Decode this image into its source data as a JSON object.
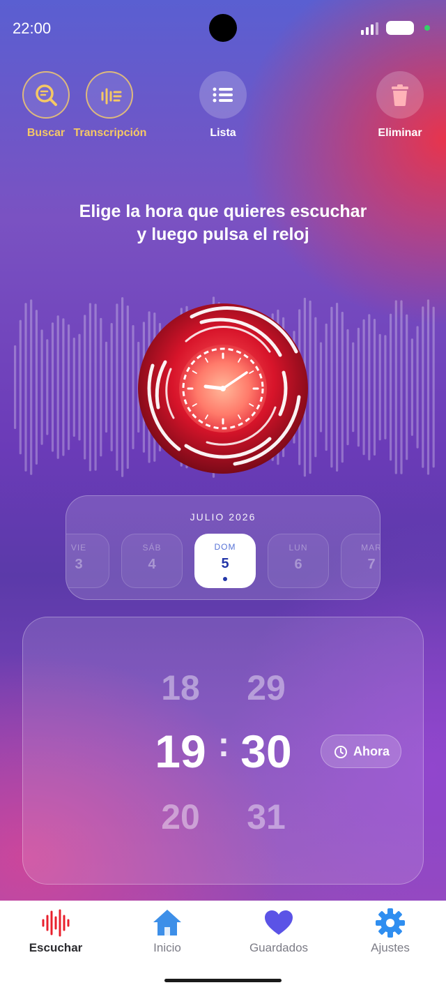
{
  "status": {
    "time": "22:00"
  },
  "toolbar": {
    "search_label": "Buscar",
    "transcription_label": "Transcripción",
    "list_label": "Lista",
    "delete_label": "Eliminar"
  },
  "headline": {
    "line1": "Elige la hora que quieres escuchar",
    "line2": "y luego pulsa el reloj"
  },
  "calendar": {
    "month": "JULIO 2026",
    "days": [
      {
        "name": "VIE",
        "num": "3"
      },
      {
        "name": "SÁB",
        "num": "4"
      },
      {
        "name": "DOM",
        "num": "5"
      },
      {
        "name": "LUN",
        "num": "6"
      },
      {
        "name": "MAR",
        "num": "7"
      }
    ],
    "selected_index": 2
  },
  "time_picker": {
    "hour_prev": "18",
    "minute_prev": "29",
    "hour": "19",
    "separator": ":",
    "minute": "30",
    "hour_next": "20",
    "minute_next": "31",
    "now_label": "Ahora"
  },
  "tabs": [
    {
      "label": "Escuchar",
      "icon": "waveform-icon",
      "active": true
    },
    {
      "label": "Inicio",
      "icon": "home-icon",
      "active": false
    },
    {
      "label": "Guardados",
      "icon": "heart-icon",
      "active": false
    },
    {
      "label": "Ajustes",
      "icon": "gear-icon",
      "active": false
    }
  ],
  "colors": {
    "accent_gold": "#f5c865",
    "record_red": "#e8202c",
    "selected_blue": "#2336a8"
  }
}
